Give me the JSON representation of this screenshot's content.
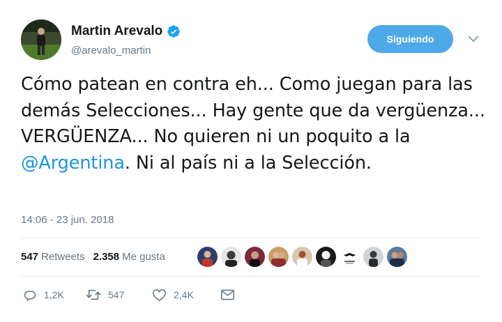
{
  "author": {
    "display_name": "Martin Arevalo",
    "handle": "@arevalo_martin",
    "verified": true
  },
  "follow_button": {
    "label": "Siguiendo"
  },
  "tweet": {
    "text_before_mention": "Cómo patean en contra eh... Como juegan para las demás Selecciones... Hay gente que da vergüenza... VERGÜENZA... No quieren ni un poquito a la ",
    "mention": "@Argentina",
    "text_after_mention": ". Ni al país ni a la Selección.",
    "timestamp": "14:06 - 23 jun. 2018"
  },
  "stats": {
    "retweets_count": "547",
    "retweets_label": "Retweets",
    "likes_count": "2.358",
    "likes_label": "Me gusta"
  },
  "actions": {
    "reply_count": "1,2K",
    "retweet_count": "547",
    "like_count": "2,4K"
  },
  "colors": {
    "accent": "#1b95e0",
    "follow_bg": "#4ea9e8",
    "muted": "#657786"
  },
  "icons": [
    "verified-badge-icon",
    "chevron-down-icon",
    "reply-icon",
    "retweet-icon",
    "heart-icon",
    "direct-message-icon"
  ]
}
